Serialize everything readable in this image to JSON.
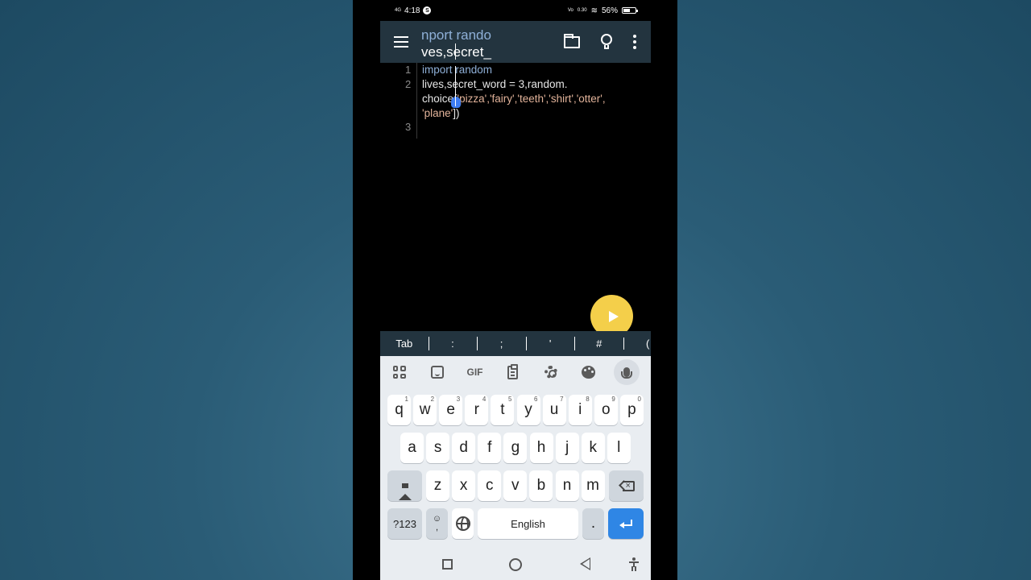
{
  "status_bar": {
    "time": "4:18",
    "network_left": "4G",
    "notification": "S",
    "volte": "Vo",
    "data_speed": "0.30",
    "battery_percent": "56%",
    "battery_level": 0.56
  },
  "toolbar": {
    "magnifier_line1": "nport rando",
    "magnifier_line2": "ves,secret_"
  },
  "editor": {
    "line_numbers": [
      "1",
      "2",
      "3"
    ],
    "line1": "import random",
    "line2a": "lives,secret_word = 3,random.",
    "line2b_prefix": "choice(",
    "line2b_strings": "'pizza','fairy','teeth','shirt','otter',",
    "line2c_strings": "'plane'",
    "line2c_suffix": "])"
  },
  "symbol_bar": {
    "keys": [
      "Tab",
      ":",
      ";",
      "'",
      "#",
      "("
    ]
  },
  "keyboard": {
    "toolbar": {
      "gif_label": "GIF"
    },
    "row1": [
      {
        "key": "q",
        "hint": "1"
      },
      {
        "key": "w",
        "hint": "2"
      },
      {
        "key": "e",
        "hint": "3"
      },
      {
        "key": "r",
        "hint": "4"
      },
      {
        "key": "t",
        "hint": "5"
      },
      {
        "key": "y",
        "hint": "6"
      },
      {
        "key": "u",
        "hint": "7"
      },
      {
        "key": "i",
        "hint": "8"
      },
      {
        "key": "o",
        "hint": "9"
      },
      {
        "key": "p",
        "hint": "0"
      }
    ],
    "row2": [
      "a",
      "s",
      "d",
      "f",
      "g",
      "h",
      "j",
      "k",
      "l"
    ],
    "row3": [
      "z",
      "x",
      "c",
      "v",
      "b",
      "n",
      "m"
    ],
    "symbols_key": "?123",
    "emoji_comma_top": "☺",
    "emoji_comma_bottom": ",",
    "space_label": "English",
    "period_key": "."
  },
  "colors": {
    "toolbar_bg": "#23343f",
    "run_button": "#f4cf4a",
    "enter_key": "#2f86e5",
    "keyboard_bg": "#e9edf1"
  }
}
